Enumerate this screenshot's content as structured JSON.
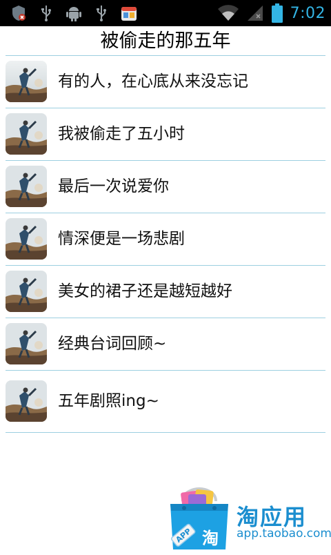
{
  "status_bar": {
    "time": "7:02",
    "left_icons": [
      "shield-icon",
      "usb-icon",
      "android-debug-icon",
      "usb-icon",
      "store-icon"
    ],
    "right_icons": [
      "wifi-icon",
      "signal-icon",
      "battery-icon"
    ],
    "accent_color": "#33b5e5"
  },
  "header": {
    "title": "被偷走的那五年"
  },
  "list": {
    "items": [
      {
        "label": "有的人，在心底从来没忘记"
      },
      {
        "label": "我被偷走了五小时"
      },
      {
        "label": "最后一次说爱你"
      },
      {
        "label": "情深便是一场悲剧"
      },
      {
        "label": "美女的裙子还是越短越好"
      },
      {
        "label": "经典台词回顾~"
      },
      {
        "label": "五年剧照ing~"
      }
    ]
  },
  "branding": {
    "name": "淘应用",
    "url": "app.taobao.com",
    "bag_text": "APP",
    "bag_char": "淘",
    "color": "#1b8ecf"
  }
}
